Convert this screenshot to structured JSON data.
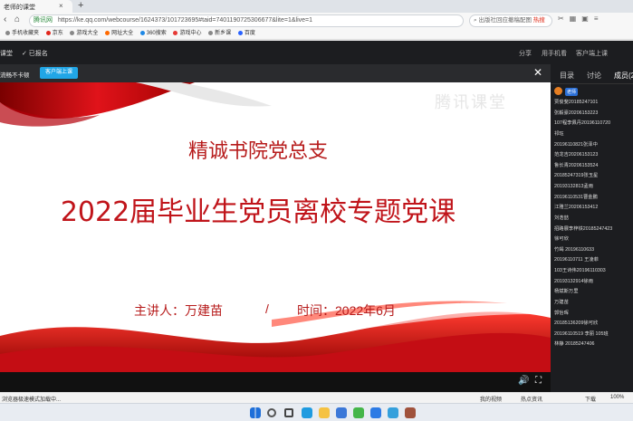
{
  "browser": {
    "tab_title": "老师的课堂",
    "tab_close": "×",
    "tab_add": "+",
    "url_site": "腾讯网",
    "url": "https://ke.qq.com/webcourse/1624373/101723695#taid=7401190725306677&lite=1&live=1",
    "search_text": "出版社回应撤稿配图",
    "search_hot": "热搜",
    "bookmarks": [
      "手机收藏夹",
      "京东",
      "游戏大全",
      "网址大全",
      "360搜索",
      "游戏中心",
      "新乡课",
      "百度"
    ],
    "bookmark_colors": [
      "#888888",
      "#e1251b",
      "#888888",
      "#ff6a00",
      "#1e88e5",
      "#e53935",
      "#888888",
      "#2962ff"
    ]
  },
  "header": {
    "left1": "课堂",
    "left2": "✓ 已报名",
    "share": "分享",
    "phone": "用手机看",
    "client": "客户端上课"
  },
  "player": {
    "top_left": "流畅不卡顿",
    "top_button": "客户端上课",
    "close": "✕",
    "volume_icon": "🔊",
    "fullscreen_icon": "⛶"
  },
  "slide": {
    "watermark": "腾讯课堂",
    "title1": "精诚书院党总支",
    "title2": "2022届毕业生党员离校专题党课",
    "speaker": "主讲人：万建苗",
    "slash": "/",
    "time": "时间：2022年6月"
  },
  "side": {
    "tabs": [
      "目录",
      "讨论",
      "成员(2"
    ],
    "teacher_badge": "老师",
    "members": [
      "贾俊斐20185247101",
      "张毅豪20206153223",
      "107程李佩丹20196110720",
      "祁珏",
      "20196110821张泽中",
      "范龙吉20206153123",
      "鲁长青20206153524",
      "20185247319张玉星",
      "20193132813孟雨",
      "20196110531曹金鹏",
      "江雅兰20206153412",
      "刘浩喆",
      "招路展李梓铁20185247423",
      "徐可欣",
      "竹竭 20196110633",
      "20196110711 王凌菲",
      "103王诗伟20196110303",
      "20193132914徐雨",
      "杨斌斯万里",
      "万建苗",
      "郭怡晖",
      "20185136209徐可欣",
      "20196110519 李丽 105班",
      "林静 20185247406"
    ]
  },
  "status": {
    "left": "浏览器极速模式加载中...",
    "video": "我的视频",
    "hot": "热点资讯",
    "download": "下载",
    "zoom": "100%"
  },
  "taskbar": {
    "icons": [
      "windows-start-icon",
      "search-icon",
      "task-view-icon",
      "edge-icon",
      "file-explorer-icon",
      "store-icon",
      "browser-360-icon",
      "app-blue-icon",
      "app-chat-icon",
      "app-photo-icon"
    ],
    "colors": [
      "#1e6fd9",
      "#555555",
      "#444444",
      "#1f9be0",
      "#f5c242",
      "#3c78d8",
      "#45b649",
      "#2d7be5",
      "#35a0dc",
      "#a0523c"
    ]
  }
}
